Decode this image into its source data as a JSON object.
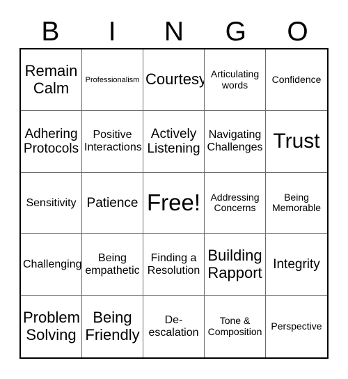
{
  "card": {
    "header_letters": [
      "B",
      "I",
      "N",
      "G",
      "O"
    ],
    "free_space_label": "Free!",
    "rows": [
      [
        {
          "text": "Remain\nCalm",
          "size": "xl"
        },
        {
          "text": "Professionalism",
          "size": "xs"
        },
        {
          "text": "Courtesy",
          "size": "xl"
        },
        {
          "text": "Articulating\nwords",
          "size": "s"
        },
        {
          "text": "Confidence",
          "size": "s"
        }
      ],
      [
        {
          "text": "Adhering\nProtocols",
          "size": "l"
        },
        {
          "text": "Positive\nInteractions",
          "size": "m"
        },
        {
          "text": "Actively\nListening",
          "size": "l"
        },
        {
          "text": "Navigating\nChallenges",
          "size": "m"
        },
        {
          "text": "Trust",
          "size": "xxl"
        }
      ],
      [
        {
          "text": "Sensitivity",
          "size": "m"
        },
        {
          "text": "Patience",
          "size": "l"
        },
        {
          "text": "Free!",
          "size": "free"
        },
        {
          "text": "Addressing\nConcerns",
          "size": "s"
        },
        {
          "text": "Being\nMemorable",
          "size": "s"
        }
      ],
      [
        {
          "text": "Challenging",
          "size": "m"
        },
        {
          "text": "Being\nempathetic",
          "size": "m"
        },
        {
          "text": "Finding a\nResolution",
          "size": "m"
        },
        {
          "text": "Building\nRapport",
          "size": "xl"
        },
        {
          "text": "Integrity",
          "size": "l"
        }
      ],
      [
        {
          "text": "Problem\nSolving",
          "size": "xl"
        },
        {
          "text": "Being\nFriendly",
          "size": "xl"
        },
        {
          "text": "De-\nescalation",
          "size": "m"
        },
        {
          "text": "Tone &\nComposition",
          "size": "s"
        },
        {
          "text": "Perspective",
          "size": "s"
        }
      ]
    ]
  },
  "style": {
    "background_color": "#ffffff",
    "text_color": "#000000",
    "outer_border_color": "#000000",
    "inner_grid_line_color": "#6b6b6b"
  }
}
